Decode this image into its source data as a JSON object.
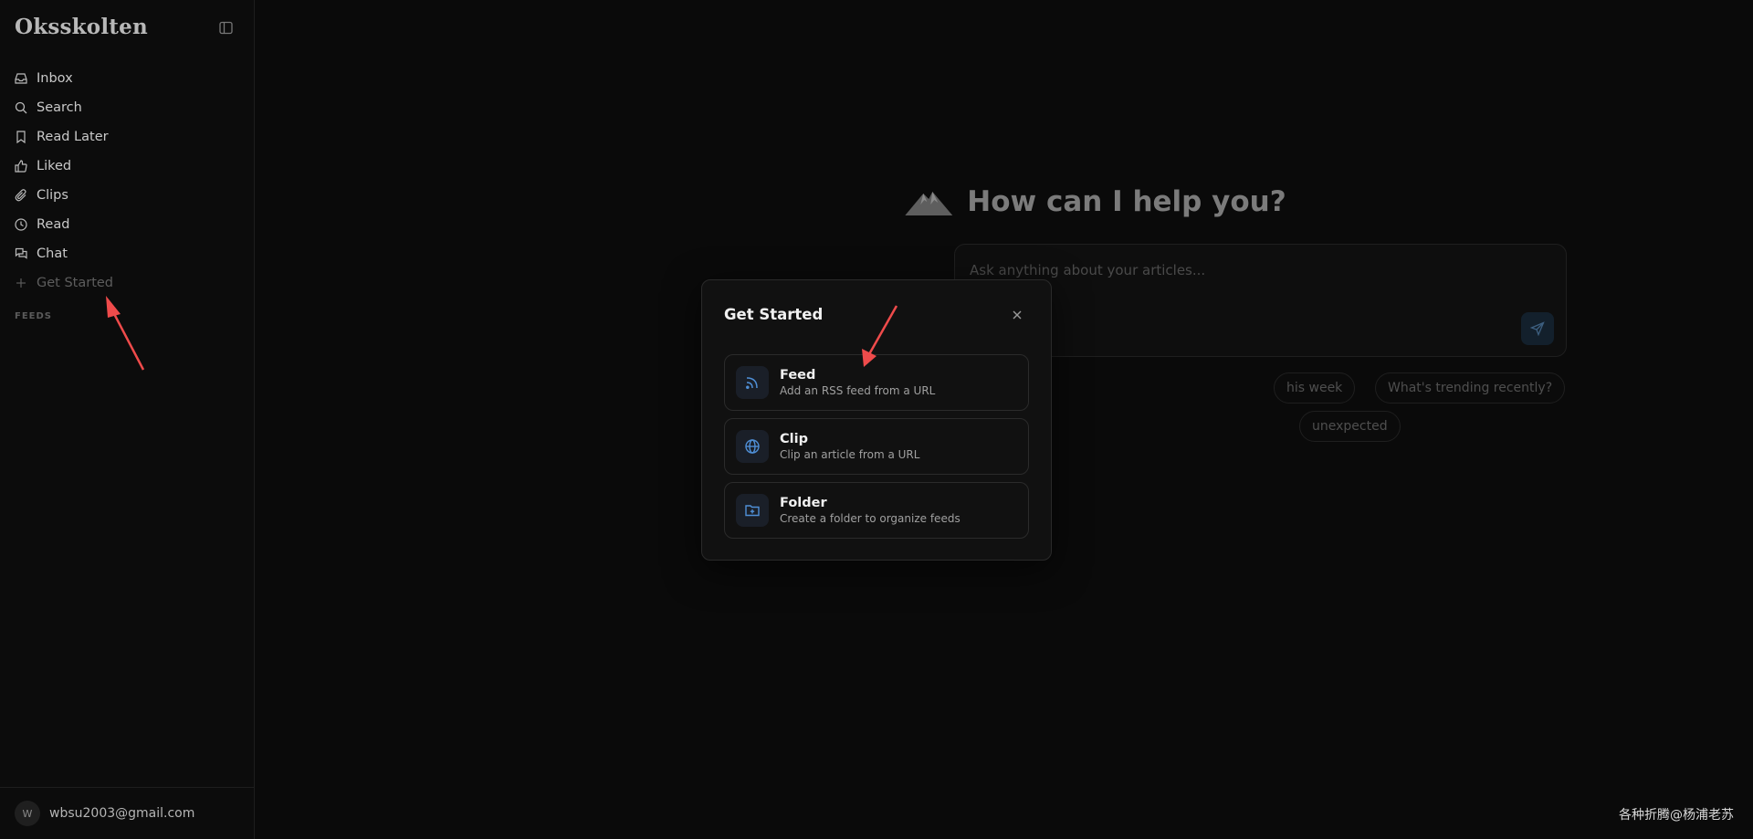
{
  "app": {
    "name": "Oksskolten"
  },
  "sidebar": {
    "items": [
      {
        "label": "Inbox",
        "icon": "inbox-icon"
      },
      {
        "label": "Search",
        "icon": "search-icon"
      },
      {
        "label": "Read Later",
        "icon": "bookmark-icon"
      },
      {
        "label": "Liked",
        "icon": "thumbs-up-icon"
      },
      {
        "label": "Clips",
        "icon": "paperclip-icon"
      },
      {
        "label": "Read",
        "icon": "clock-icon"
      },
      {
        "label": "Chat",
        "icon": "chat-icon"
      },
      {
        "label": "Get Started",
        "icon": "plus-icon"
      }
    ],
    "section_label": "FEEDS",
    "user": {
      "initial": "W",
      "email": "wbsu2003@gmail.com"
    }
  },
  "main": {
    "heading": "How can I help you?",
    "chat_placeholder": "Ask anything about your articles...",
    "suggestion_chips": [
      "his week",
      "What's trending recently?",
      "unexpected"
    ]
  },
  "modal": {
    "title": "Get Started",
    "options": [
      {
        "title": "Feed",
        "description": "Add an RSS feed from a URL",
        "icon": "rss-icon"
      },
      {
        "title": "Clip",
        "description": "Clip an article from a URL",
        "icon": "globe-icon"
      },
      {
        "title": "Folder",
        "description": "Create a folder to organize feeds",
        "icon": "folder-plus-icon"
      }
    ]
  },
  "colors": {
    "accent": "#4f8fd6",
    "annotation_arrow": "#ef4b4b",
    "background": "#0a0a0a"
  },
  "watermark": "各种折腾@杨浦老苏"
}
